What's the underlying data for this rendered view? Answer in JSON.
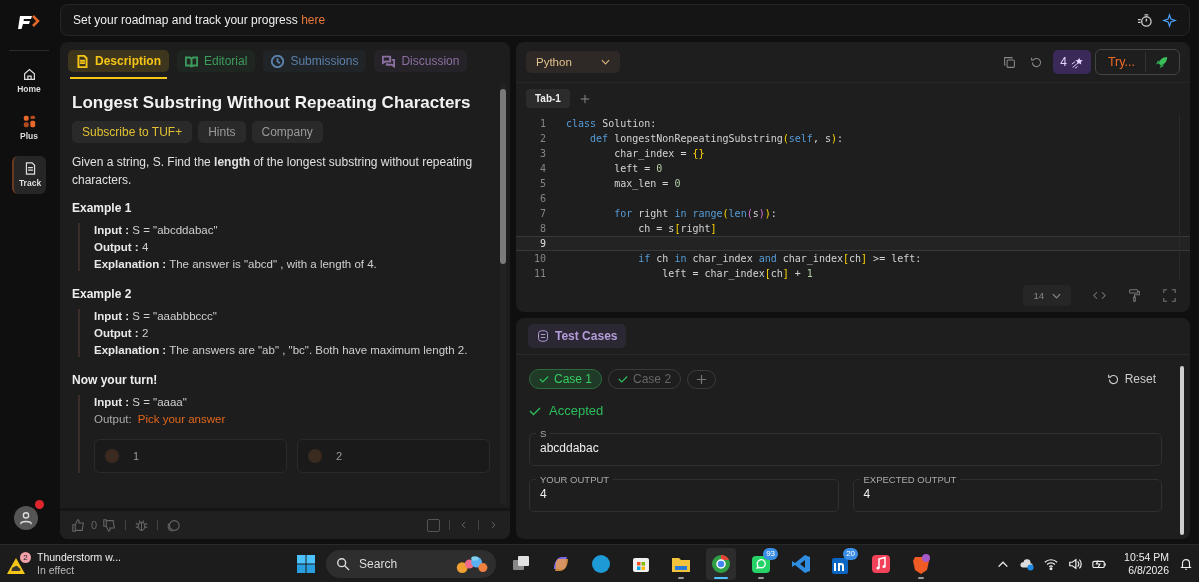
{
  "sidebar": {
    "items": [
      {
        "label": "Home",
        "kind": "home",
        "selected": false
      },
      {
        "label": "Plus",
        "kind": "plus",
        "selected": false
      },
      {
        "label": "Track",
        "kind": "track",
        "selected": true
      }
    ],
    "avatar": {
      "notification": true
    }
  },
  "banner": {
    "text": "Set your roadmap and track your progress ",
    "link": "here"
  },
  "problem": {
    "tabs": [
      {
        "label": "Description",
        "kind": "doc",
        "color": "#f5c518",
        "selected": true
      },
      {
        "label": "Editorial",
        "kind": "book",
        "color": "#3d9a5c",
        "selected": false
      },
      {
        "label": "Submissions",
        "kind": "clock",
        "color": "#5a7fa8",
        "selected": false
      },
      {
        "label": "Discussion",
        "kind": "chat",
        "color": "#8a6fa0",
        "selected": false
      }
    ],
    "title": "Longest Substring Without Repeating Characters",
    "tags": [
      {
        "label": "Subscribe to TUF+",
        "kind": "premium"
      },
      {
        "label": "Hints",
        "kind": "plain"
      },
      {
        "label": "Company",
        "kind": "plain"
      }
    ],
    "description": "Given a string, S. Find the **length** of the longest substring without repeating characters.",
    "examples": [
      {
        "heading": "Example 1",
        "input_label": "Input :",
        "input": "S = \"abcddabac\"",
        "output_label": "Output :",
        "output": "4",
        "explanation_label": "Explanation :",
        "explanation": "The answer is \"abcd\" , with a length of 4."
      },
      {
        "heading": "Example 2",
        "input_label": "Input :",
        "input": "S = \"aaabbbccc\"",
        "output_label": "Output :",
        "output": "2",
        "explanation_label": "Explanation :",
        "explanation": "The answers are \"ab\" , \"bc\". Both have maximum length 2."
      }
    ],
    "your_turn": {
      "heading": "Now your turn!",
      "input_label": "Input :",
      "input": "S = \"aaaa\"",
      "output_label": "Output:",
      "prompt": "Pick your answer",
      "options": [
        "1",
        "2"
      ]
    },
    "footer": {
      "likes": "0"
    }
  },
  "editor": {
    "language": "Python",
    "streak": "4",
    "try_label": "Try...",
    "tabs": [
      {
        "label": "Tab-1",
        "selected": true
      }
    ],
    "lines": [
      {
        "number": "1",
        "current": false,
        "tokens": [
          {
            "t": "class",
            "kind": "kw"
          },
          {
            "t": " Solution:",
            "kind": "plain"
          }
        ]
      },
      {
        "number": "2",
        "current": false,
        "tokens": [
          {
            "t": "    def",
            "kind": "kw"
          },
          {
            "t": " longestNonRepeatingSubstring",
            "kind": "plain"
          },
          {
            "t": "(",
            "kind": "br1"
          },
          {
            "t": "self",
            "kind": "kw"
          },
          {
            "t": ", s",
            "kind": "plain"
          },
          {
            "t": ")",
            "kind": "br1"
          },
          {
            "t": ":",
            "kind": "plain"
          }
        ]
      },
      {
        "number": "3",
        "current": false,
        "tokens": [
          {
            "t": "        char_index = ",
            "kind": "plain"
          },
          {
            "t": "{}",
            "kind": "br1"
          }
        ]
      },
      {
        "number": "4",
        "current": false,
        "tokens": [
          {
            "t": "        left = ",
            "kind": "plain"
          },
          {
            "t": "0",
            "kind": "num"
          }
        ]
      },
      {
        "number": "5",
        "current": false,
        "tokens": [
          {
            "t": "        max_len = ",
            "kind": "plain"
          },
          {
            "t": "0",
            "kind": "num"
          }
        ]
      },
      {
        "number": "6",
        "current": false
      },
      {
        "number": "7",
        "current": false,
        "tokens": [
          {
            "t": "        for",
            "kind": "kw"
          },
          {
            "t": " right ",
            "kind": "plain"
          },
          {
            "t": "in range",
            "kind": "kw"
          },
          {
            "t": "(",
            "kind": "br1"
          },
          {
            "t": "len",
            "kind": "kw"
          },
          {
            "t": "(",
            "kind": "br2"
          },
          {
            "t": "s",
            "kind": "plain"
          },
          {
            "t": ")",
            "kind": "br2"
          },
          {
            "t": ")",
            "kind": "br1"
          },
          {
            "t": ":",
            "kind": "plain"
          }
        ]
      },
      {
        "number": "8",
        "current": false,
        "tokens": [
          {
            "t": "            ch = s",
            "kind": "plain"
          },
          {
            "t": "[",
            "kind": "br1"
          },
          {
            "t": "right",
            "kind": "plain"
          },
          {
            "t": "]",
            "kind": "br1"
          }
        ]
      },
      {
        "number": "9",
        "current": true
      },
      {
        "number": "10",
        "current": false,
        "tokens": [
          {
            "t": "            if",
            "kind": "kw"
          },
          {
            "t": " ch ",
            "kind": "plain"
          },
          {
            "t": "in",
            "kind": "kw"
          },
          {
            "t": " char_index ",
            "kind": "plain"
          },
          {
            "t": "and",
            "kind": "kw"
          },
          {
            "t": " char_index",
            "kind": "plain"
          },
          {
            "t": "[",
            "kind": "br1"
          },
          {
            "t": "ch",
            "kind": "plain"
          },
          {
            "t": "]",
            "kind": "br1"
          },
          {
            "t": " >= left:",
            "kind": "plain"
          }
        ]
      },
      {
        "number": "11",
        "current": false,
        "tokens": [
          {
            "t": "                left = char_index",
            "kind": "plain"
          },
          {
            "t": "[",
            "kind": "br1"
          },
          {
            "t": "ch",
            "kind": "plain"
          },
          {
            "t": "]",
            "kind": "br1"
          },
          {
            "t": " + ",
            "kind": "plain"
          },
          {
            "t": "1",
            "kind": "num"
          }
        ]
      }
    ],
    "font_size": "14"
  },
  "tests": {
    "title": "Test Cases",
    "cases": [
      {
        "label": "Case 1",
        "passed": true,
        "selected": true
      },
      {
        "label": "Case 2",
        "passed": true,
        "selected": false
      }
    ],
    "reset": "Reset",
    "status": "Accepted",
    "input": {
      "label": "S",
      "value": "abcddabac"
    },
    "your_output": {
      "label": "YOUR OUTPUT",
      "value": "4"
    },
    "expected_output": {
      "label": "EXPECTED OUTPUT",
      "value": "4"
    }
  },
  "taskbar": {
    "weather": {
      "badge": "2",
      "title": "Thunderstorm w...",
      "subtitle": "In effect"
    },
    "search": {
      "placeholder": "Search"
    },
    "apps": [
      {
        "kind": "taskview",
        "active": false,
        "running": false
      },
      {
        "kind": "copilot",
        "active": false,
        "running": false
      },
      {
        "kind": "edge",
        "active": false,
        "running": false
      },
      {
        "kind": "store",
        "active": false,
        "running": false
      },
      {
        "kind": "folder",
        "active": false,
        "running": true
      },
      {
        "kind": "chrome",
        "active": true,
        "running": true
      },
      {
        "kind": "whatsapp",
        "badge": "93",
        "active": false,
        "running": true
      },
      {
        "kind": "vscode",
        "active": false,
        "running": false
      },
      {
        "kind": "linkedin",
        "badge": "20",
        "active": false,
        "running": false
      },
      {
        "kind": "music",
        "active": false,
        "running": false
      },
      {
        "kind": "brave",
        "active": false,
        "running": true
      }
    ],
    "time": "10:54 PM",
    "date": "6/8/2026"
  }
}
